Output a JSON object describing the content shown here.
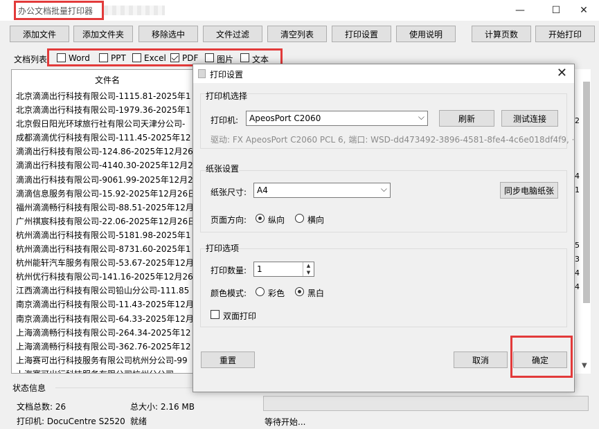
{
  "window": {
    "title": "办公文档批量打印器",
    "controls": {
      "minimize": "—",
      "maximize": "☐",
      "close": "✕"
    }
  },
  "toolbar": {
    "add_file": "添加文件",
    "add_folder": "添加文件夹",
    "remove_selected": "移除选中",
    "file_filter": "文件过滤",
    "clear_list": "清空列表",
    "print_settings": "打印设置",
    "help": "使用说明",
    "count_pages": "计算页数",
    "start_print": "开始打印"
  },
  "filters": {
    "label": "文档列表",
    "items": [
      {
        "label": "Word",
        "checked": false
      },
      {
        "label": "PPT",
        "checked": false
      },
      {
        "label": "Excel",
        "checked": false
      },
      {
        "label": "PDF",
        "checked": true
      },
      {
        "label": "图片",
        "checked": false
      },
      {
        "label": "文本",
        "checked": false
      }
    ]
  },
  "file_list": {
    "header": "文件名",
    "rows": [
      "北京滴滴出行科技有限公司-1115.81-2025年1",
      "北京滴滴出行科技有限公司-1979.36-2025年1",
      "北京假日阳光环球旅行社有限公司天津分公司-",
      "成都滴滴优行科技有限公司-111.45-2025年12",
      "滴滴出行科技有限公司-124.86-2025年12月26",
      "滴滴出行科技有限公司-4140.30-2025年12月2",
      "滴滴出行科技有限公司-9061.99-2025年12月2",
      "滴滴信息服务有限公司-15.92-2025年12月26日",
      "福州滴滴畅行科技有限公司-88.51-2025年12月",
      "广州祺宸科技有限公司-22.06-2025年12月26日",
      "杭州滴滴出行科技有限公司-5181.98-2025年1",
      "杭州滴滴出行科技有限公司-8731.60-2025年1",
      "杭州能轩汽车服务有限公司-53.67-2025年12月",
      "杭州优行科技有限公司-141.16-2025年12月26",
      "江西滴滴出行科技有限公司铅山分公司-111.85",
      "南京滴滴出行科技有限公司-11.43-2025年12月",
      "南京滴滴出行科技有限公司-64.33-2025年12月",
      "上海滴滴畅行科技有限公司-264.34-2025年12",
      "上海滴滴畅行科技有限公司-362.76-2025年12",
      "上海赛可出行科技服务有限公司杭州分公司-99",
      "上海赛可出行科技服务有限公司杭州分公司-"
    ],
    "right_fragments": [
      "2",
      "4",
      "1",
      "5",
      "3",
      "4",
      "4"
    ]
  },
  "status": {
    "title": "状态信息",
    "doc_count_label": "文档总数: 26",
    "total_size_label": "总大小: 2.16 MB",
    "printer_label": "打印机: DocuCentre S2520",
    "printer_state": "就绪",
    "progress_text": "等待开始...",
    "progress_value": 0
  },
  "dialog": {
    "title": "打印设置",
    "close": "✕",
    "printer_group": {
      "title": "打印机选择",
      "printer_label": "打印机:",
      "printer_value": "ApeosPort C2060",
      "refresh": "刷新",
      "test_connection": "测试连接",
      "driver_info": "驱动: FX ApeosPort C2060 PCL 6, 端口: WSD-dd473492-3896-4581-8fe4-4c6e018df4f9, ·"
    },
    "paper_group": {
      "title": "纸张设置",
      "size_label": "纸张尺寸:",
      "size_value": "A4",
      "sync_paper": "同步电脑纸张",
      "orientation_label": "页面方向:",
      "portrait": "纵向",
      "landscape": "横向",
      "orientation_selected": "portrait"
    },
    "print_group": {
      "title": "打印选项",
      "copies_label": "打印数量:",
      "copies_value": "1",
      "color_label": "颜色模式:",
      "color": "彩色",
      "mono": "黑白",
      "color_selected": "mono",
      "duplex_label": "双面打印",
      "duplex_checked": false
    },
    "reset": "重置",
    "cancel": "取消",
    "ok": "确定"
  },
  "colors": {
    "highlight_box": "#e23a3a",
    "button_face": "#e1e1e1",
    "window_bg": "#f0f0f0"
  }
}
